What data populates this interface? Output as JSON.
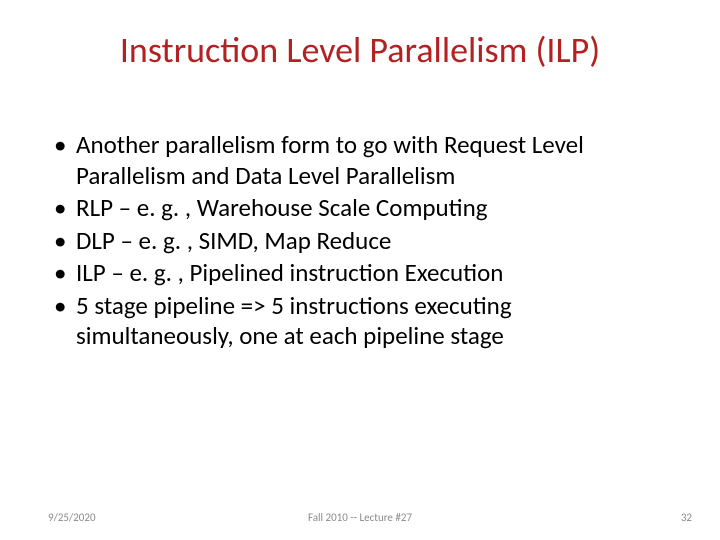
{
  "title": "Instruction Level Parallelism (ILP)",
  "bullets": [
    "Another parallelism form to go with Request Level Parallelism and Data Level Parallelism",
    "RLP – e. g. , Warehouse Scale Computing",
    "DLP – e. g. , SIMD, Map Reduce",
    "ILP – e. g. ,  Pipelined instruction Execution",
    "5 stage pipeline => 5 instructions executing simultaneously, one at each pipeline stage"
  ],
  "footer": {
    "date": "9/25/2020",
    "center": "Fall 2010 -- Lecture #27",
    "page": "32"
  }
}
